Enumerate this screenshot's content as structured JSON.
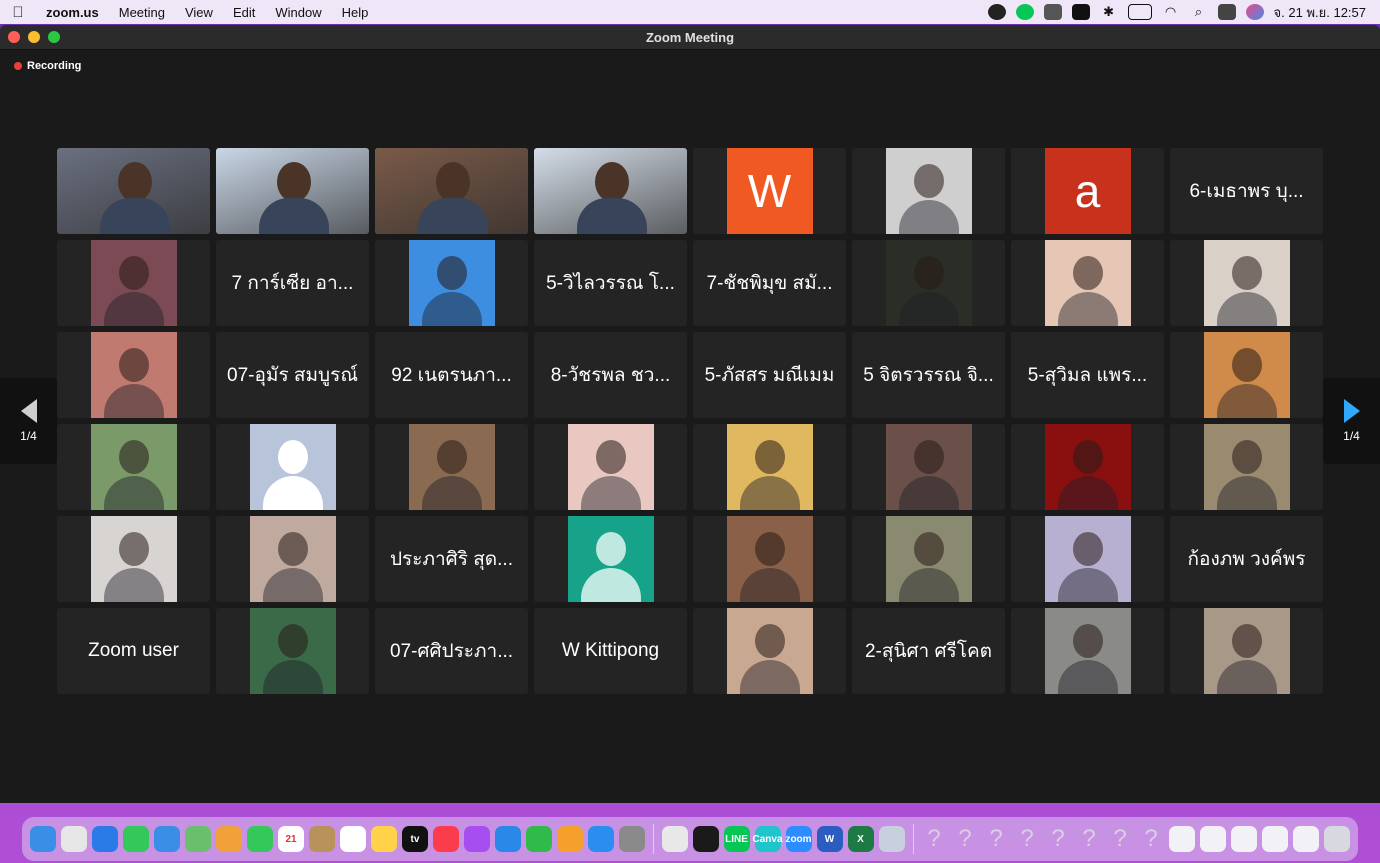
{
  "menubar": {
    "app_name": "zoom.us",
    "items": [
      "Meeting",
      "View",
      "Edit",
      "Window",
      "Help"
    ],
    "clock": "จ. 21 พ.ย. 12:57"
  },
  "window": {
    "title": "Zoom Meeting",
    "recording_label": "Recording"
  },
  "pager": {
    "left_count": "1/4",
    "right_count": "1/4"
  },
  "tiles": [
    {
      "type": "video",
      "label": "",
      "bg": "#6b7080"
    },
    {
      "type": "video",
      "label": "",
      "bg": "#c9d6e6"
    },
    {
      "type": "video",
      "label": "",
      "bg": "#7a5a48",
      "active": true
    },
    {
      "type": "video",
      "label": "",
      "bg": "#d4dde8"
    },
    {
      "type": "letter",
      "label": "W",
      "bg": "#f05a22"
    },
    {
      "type": "photo",
      "label": "",
      "bg": "#cfcfcf"
    },
    {
      "type": "letter",
      "label": "a",
      "bg": "#c8321c"
    },
    {
      "type": "name",
      "label": "6-เมธาพร บุ..."
    },
    {
      "type": "photo",
      "label": "",
      "bg": "#7c4a54"
    },
    {
      "type": "name",
      "label": "7 การ์เซีย อา..."
    },
    {
      "type": "photo",
      "label": "",
      "bg": "#3d8de0"
    },
    {
      "type": "name",
      "label": "5-วิไลวรรณ โ..."
    },
    {
      "type": "name",
      "label": "7-ชัชพิมุข สมั..."
    },
    {
      "type": "photo",
      "label": "",
      "bg": "#2a2e26"
    },
    {
      "type": "photo",
      "label": "",
      "bg": "#e6c6b4"
    },
    {
      "type": "photo",
      "label": "",
      "bg": "#d9d0c8"
    },
    {
      "type": "photo",
      "label": "",
      "bg": "#c07a70"
    },
    {
      "type": "name",
      "label": "07-อุมัร สมบูรณ์"
    },
    {
      "type": "name",
      "label": "92 เนตรนภา..."
    },
    {
      "type": "name",
      "label": "8-วัชรพล ชว..."
    },
    {
      "type": "name",
      "label": "5-ภัสสร มณีเมม"
    },
    {
      "type": "name",
      "label": "5 จิตรวรรณ จิ..."
    },
    {
      "type": "name",
      "label": "5-สุวิมล แพร..."
    },
    {
      "type": "photo",
      "label": "",
      "bg": "#d08a4a"
    },
    {
      "type": "photo",
      "label": "",
      "bg": "#7a9a6a"
    },
    {
      "type": "silhouette",
      "label": "",
      "bg": "#b8c4da"
    },
    {
      "type": "photo",
      "label": "",
      "bg": "#8a6a50"
    },
    {
      "type": "photo",
      "label": "",
      "bg": "#e8c8c0"
    },
    {
      "type": "photo",
      "label": "",
      "bg": "#e0b860"
    },
    {
      "type": "photo",
      "label": "",
      "bg": "#6a5048"
    },
    {
      "type": "photo",
      "label": "",
      "bg": "#8a1010"
    },
    {
      "type": "photo",
      "label": "",
      "bg": "#9a8a70"
    },
    {
      "type": "photo",
      "label": "",
      "bg": "#d8d4d2"
    },
    {
      "type": "photo",
      "label": "",
      "bg": "#c0aaa0"
    },
    {
      "type": "name",
      "label": "ประภาศิริ สุด..."
    },
    {
      "type": "default",
      "label": "",
      "bg": "#17a38a"
    },
    {
      "type": "photo",
      "label": "",
      "bg": "#8a6048"
    },
    {
      "type": "photo",
      "label": "",
      "bg": "#8a8a70"
    },
    {
      "type": "photo",
      "label": "",
      "bg": "#b8b0d0"
    },
    {
      "type": "name",
      "label": "ก้องภพ วงค์พร"
    },
    {
      "type": "name",
      "label": "Zoom user"
    },
    {
      "type": "photo",
      "label": "",
      "bg": "#3a6a48"
    },
    {
      "type": "name",
      "label": "07-ศศิประภา..."
    },
    {
      "type": "name",
      "label": "W Kittipong"
    },
    {
      "type": "photo",
      "label": "",
      "bg": "#c8a890"
    },
    {
      "type": "name",
      "label": "2-สุนิศา ศรีโคต"
    },
    {
      "type": "photo",
      "label": "",
      "bg": "#8a8a88"
    },
    {
      "type": "photo",
      "label": "",
      "bg": "#a89888"
    }
  ],
  "dock": {
    "apps": [
      {
        "name": "finder",
        "color": "#3a8ee6",
        "glyph": ""
      },
      {
        "name": "launchpad",
        "color": "#e6e6e6",
        "glyph": ""
      },
      {
        "name": "safari",
        "color": "#2a7ae8",
        "glyph": ""
      },
      {
        "name": "messages",
        "color": "#34c759",
        "glyph": ""
      },
      {
        "name": "mail",
        "color": "#3a8ee6",
        "glyph": ""
      },
      {
        "name": "maps",
        "color": "#6ac06a",
        "glyph": ""
      },
      {
        "name": "photos",
        "color": "#f2a03a",
        "glyph": ""
      },
      {
        "name": "facetime",
        "color": "#34c759",
        "glyph": ""
      },
      {
        "name": "calendar",
        "color": "#ffffff",
        "glyph": "21"
      },
      {
        "name": "contacts",
        "color": "#b8925a",
        "glyph": ""
      },
      {
        "name": "reminders",
        "color": "#ffffff",
        "glyph": ""
      },
      {
        "name": "notes",
        "color": "#ffd24a",
        "glyph": ""
      },
      {
        "name": "tv",
        "color": "#111111",
        "glyph": "tv"
      },
      {
        "name": "music",
        "color": "#fa3c4c",
        "glyph": ""
      },
      {
        "name": "podcasts",
        "color": "#a64ef0",
        "glyph": ""
      },
      {
        "name": "keynote",
        "color": "#2a88e8",
        "glyph": ""
      },
      {
        "name": "numbers",
        "color": "#2fba4a",
        "glyph": ""
      },
      {
        "name": "pages",
        "color": "#f5a02a",
        "glyph": ""
      },
      {
        "name": "app-store",
        "color": "#2a8ef0",
        "glyph": ""
      },
      {
        "name": "system-preferences",
        "color": "#8a8a8a",
        "glyph": ""
      },
      {
        "name": "chrome",
        "color": "#e8e8e8",
        "glyph": ""
      },
      {
        "name": "webex",
        "color": "#1a1a1a",
        "glyph": ""
      },
      {
        "name": "line",
        "color": "#06c755",
        "glyph": "LINE"
      },
      {
        "name": "canva",
        "color": "#20c4cb",
        "glyph": "Canva"
      },
      {
        "name": "zoom",
        "color": "#2d8cff",
        "glyph": "zoom"
      },
      {
        "name": "word",
        "color": "#2b5cc0",
        "glyph": "W"
      },
      {
        "name": "excel",
        "color": "#1e7a44",
        "glyph": "X"
      },
      {
        "name": "preview",
        "color": "#c8d0e0",
        "glyph": ""
      }
    ],
    "unknown_count": 8,
    "unknown_glyph": "?"
  }
}
